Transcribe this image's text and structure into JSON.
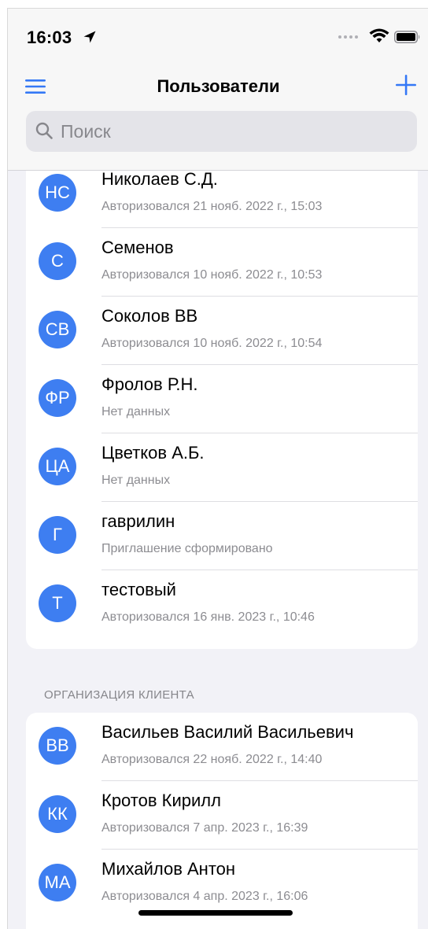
{
  "status_bar": {
    "time": "16:03"
  },
  "nav": {
    "title": "Пользователи"
  },
  "search": {
    "placeholder": "Поиск"
  },
  "groups": [
    {
      "header": "",
      "users": [
        {
          "initials": "НС",
          "name": "Николаев С.Д.",
          "status": "Авторизовался 21 нояб. 2022 г., 15:03"
        },
        {
          "initials": "С",
          "name": "Семенов",
          "status": "Авторизовался 10 нояб. 2022 г., 10:53"
        },
        {
          "initials": "СВ",
          "name": "Соколов ВВ",
          "status": "Авторизовался 10 нояб. 2022 г., 10:54"
        },
        {
          "initials": "ФР",
          "name": "Фролов Р.Н.",
          "status": "Нет данных"
        },
        {
          "initials": "ЦА",
          "name": "Цветков А.Б.",
          "status": "Нет данных"
        },
        {
          "initials": "Г",
          "name": "гаврилин",
          "status": "Приглашение сформировано"
        },
        {
          "initials": "Т",
          "name": "тестовый",
          "status": "Авторизовался 16 янв. 2023 г., 10:46"
        }
      ]
    },
    {
      "header": "ОРГАНИЗАЦИЯ КЛИЕНТА",
      "users": [
        {
          "initials": "ВВ",
          "name": "Васильев Василий Васильевич",
          "status": "Авторизовался 22 нояб. 2022 г., 14:40"
        },
        {
          "initials": "КК",
          "name": "Кротов Кирилл",
          "status": "Авторизовался 7 апр. 2023 г., 16:39"
        },
        {
          "initials": "МА",
          "name": "Михайлов Антон",
          "status": "Авторизовался 4 апр. 2023 г., 16:06"
        }
      ]
    }
  ],
  "colors": {
    "accent": "#3478f6",
    "avatar": "#3e7ef1",
    "background": "#f2f2f7",
    "secondary_text": "#8c8c91"
  },
  "icons": [
    "location-arrow-icon",
    "signal-dots-icon",
    "wifi-icon",
    "battery-icon",
    "menu-icon",
    "plus-icon",
    "search-icon"
  ]
}
